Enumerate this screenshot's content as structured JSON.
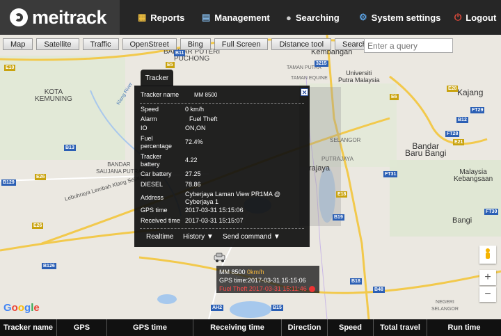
{
  "header": {
    "logo": "meitrack",
    "nav": [
      {
        "label": "Reports",
        "icon": "reports-icon"
      },
      {
        "label": "Management",
        "icon": "management-icon"
      },
      {
        "label": "Searching",
        "icon": "searching-icon"
      },
      {
        "label": "System settings",
        "icon": "gear-icon"
      },
      {
        "label": "Logout",
        "icon": "power-icon"
      }
    ]
  },
  "toolbar": {
    "buttons": [
      "Map",
      "Satellite",
      "Traffic",
      "OpenStreet",
      "Bing",
      "Full Screen",
      "Distance tool",
      "Search tracker"
    ],
    "query_placeholder": "Enter a query"
  },
  "map_labels": {
    "kota_kemuning": "KOTA\nKEMUNING",
    "bandar_puteri": "BANDAR PUTERI\nPUCHONG",
    "kembangan": "Kembangan",
    "universiti": "Universiti\nPutra Malaysia",
    "kajang": "Kajang",
    "bandar_baru_bangi": "Bandar\nBaru Bangi",
    "selangor": "SELANGOR",
    "putrajaya": "PUTRAJAYA",
    "rajaya": "rajaya",
    "bangi": "Bangi",
    "malaysia": "Malaysia\nKebangsaan",
    "taman_equine": "TAMAN EQUINE",
    "taman_putra": "TAMAN PUTRA",
    "bandar_saujana": "BANDAR\nSAUJANA PUTRA",
    "lebuhraya": "Lebuhraya Lembah Klang Selatan",
    "negeri": "NEGERI\nSELANGOR",
    "klang_river": "Klang River"
  },
  "road_tags": [
    "E10",
    "E5",
    "B11",
    "3215",
    "FT29",
    "E28",
    "B12",
    "E26",
    "B129",
    "E26",
    "B13",
    "E6",
    "FT31",
    "B126",
    "B19",
    "B18",
    "B48",
    "AH2",
    "B15",
    "FT28",
    "E21",
    "E18",
    "FT30"
  ],
  "popup": {
    "tab": "Tracker",
    "tracker_name_label": "Tracker name",
    "tracker_name": "MM 8500",
    "rows": [
      {
        "k": "Speed",
        "v": "0 km/h"
      },
      {
        "k": "Alarm",
        "v": "Fuel Theft"
      },
      {
        "k": "IO",
        "v": "ON,ON"
      },
      {
        "k": "Fuel percentage",
        "v": "72.4%"
      },
      {
        "k": "Tracker battery",
        "v": "4.22"
      },
      {
        "k": "Car battery",
        "v": "27.25"
      },
      {
        "k": "DIESEL",
        "v": "78.86"
      },
      {
        "k": "Address",
        "v": "Cyberjaya Laman View PR1MA @ Cyberjaya 1"
      },
      {
        "k": "GPS time",
        "v": "2017-03-31 15:15:06"
      },
      {
        "k": "Received time",
        "v": "2017-03-31 15:15:07"
      }
    ],
    "actions": [
      "Realtime",
      "History ▼",
      "Send command ▼"
    ]
  },
  "marker_info": {
    "name": "MM 8500",
    "speed": "0km/h",
    "gps_time": "GPS time:2017-03-31 15:15:06",
    "alarm": "Fuel Theft 2017-03-31 15:11:46"
  },
  "zoom": {
    "in": "+",
    "out": "−"
  },
  "google": "Google",
  "table_columns": [
    "Tracker name",
    "GPS",
    "GPS time",
    "Receiving time",
    "Direction",
    "Speed",
    "Total travel",
    "Run time"
  ]
}
